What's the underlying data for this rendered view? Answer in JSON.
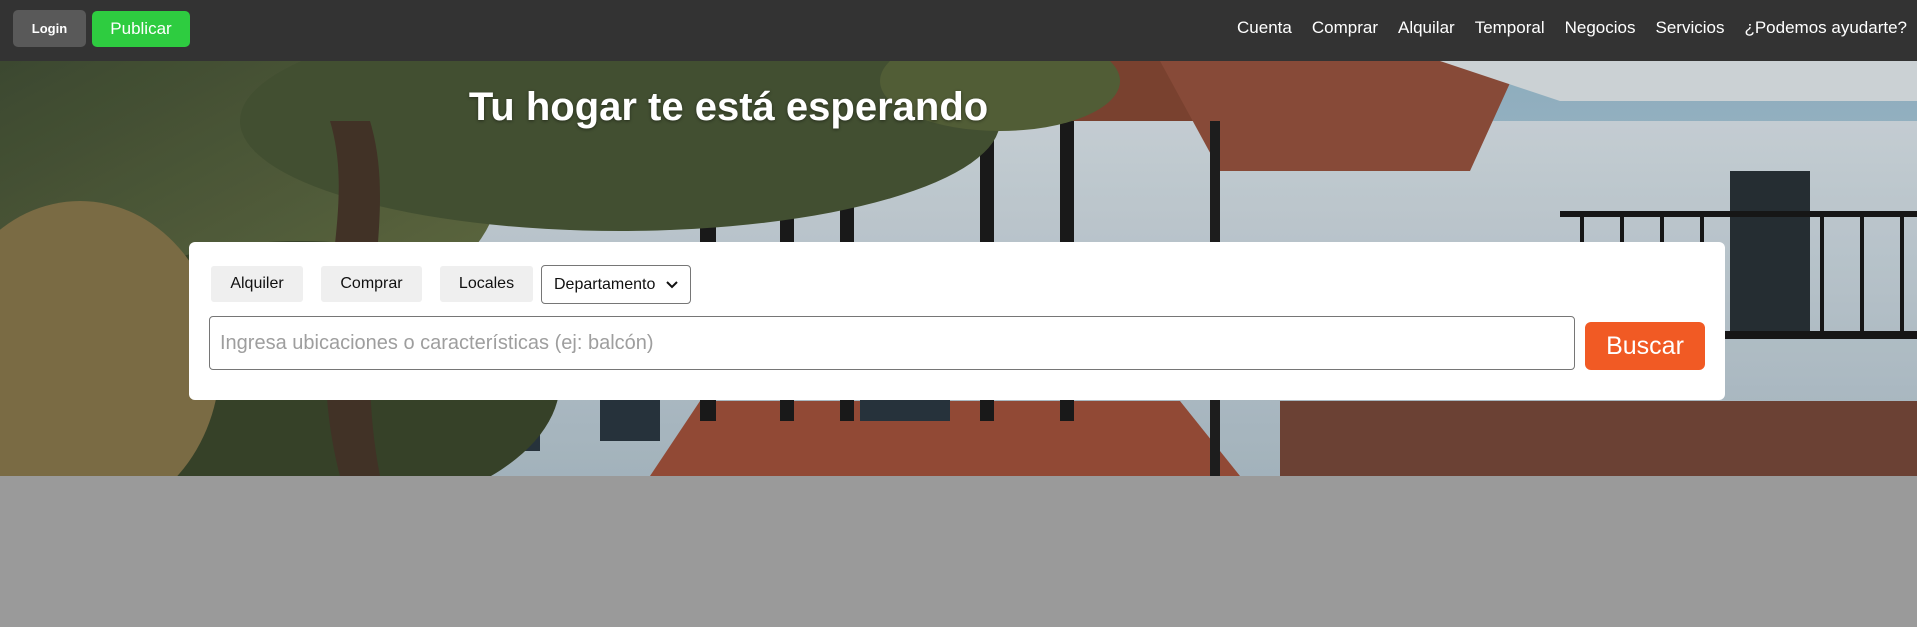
{
  "topbar": {
    "login_label": "Login",
    "publicar_label": "Publicar",
    "nav": [
      {
        "label": "Cuenta"
      },
      {
        "label": "Comprar"
      },
      {
        "label": "Alquilar"
      },
      {
        "label": "Temporal"
      },
      {
        "label": "Negocios"
      },
      {
        "label": "Servicios"
      },
      {
        "label": "¿Podemos ayudarte?"
      }
    ]
  },
  "hero": {
    "title": "Tu hogar te está esperando",
    "background": "house-with-trees-photo"
  },
  "search": {
    "tabs": [
      {
        "label": "Alquiler"
      },
      {
        "label": "Comprar"
      },
      {
        "label": "Locales"
      }
    ],
    "property_type_selected": "Departamento",
    "placeholder": "Ingresa ubicaciones o características (ej: balcón)",
    "value": "",
    "button_label": "Buscar"
  },
  "colors": {
    "topbar_bg": "#333333",
    "login_bg": "#595959",
    "publicar_bg": "#2ecc40",
    "buscar_bg": "#f15a24",
    "page_bg": "#9a9a9a"
  }
}
